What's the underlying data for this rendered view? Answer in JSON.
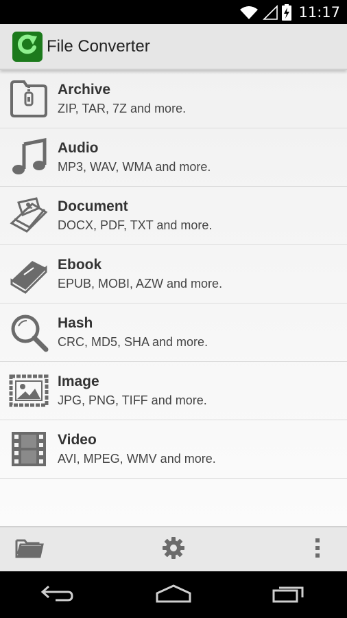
{
  "status_bar": {
    "time": "11:17",
    "icons": [
      "wifi-icon",
      "signal-icon",
      "battery-charging-icon"
    ]
  },
  "app": {
    "title": "File Converter",
    "logo_icon": "refresh-arrow-icon",
    "logo_color": "#1c7a1c"
  },
  "categories": [
    {
      "title": "Archive",
      "subtitle": "ZIP, TAR, 7Z and more.",
      "icon": "archive-icon"
    },
    {
      "title": "Audio",
      "subtitle": "MP3, WAV, WMA and more.",
      "icon": "music-note-icon"
    },
    {
      "title": "Document",
      "subtitle": "DOCX, PDF, TXT and more.",
      "icon": "document-icon"
    },
    {
      "title": "Ebook",
      "subtitle": "EPUB, MOBI, AZW and more.",
      "icon": "book-icon"
    },
    {
      "title": "Hash",
      "subtitle": "CRC, MD5, SHA and more.",
      "icon": "magnifier-icon"
    },
    {
      "title": "Image",
      "subtitle": "JPG, PNG, TIFF and more.",
      "icon": "image-icon"
    },
    {
      "title": "Video",
      "subtitle": "AVI, MPEG, WMV and more.",
      "icon": "film-icon"
    }
  ],
  "bottom_bar": {
    "icons": [
      "folder-icon",
      "gear-icon",
      "overflow-menu-icon"
    ]
  },
  "nav_bar": {
    "icons": [
      "back-icon",
      "home-icon",
      "recents-icon"
    ]
  },
  "colors": {
    "icon_gray": "#6b6b6b",
    "title_text": "#333333",
    "actionbar_bg": "#e6e6e6"
  }
}
